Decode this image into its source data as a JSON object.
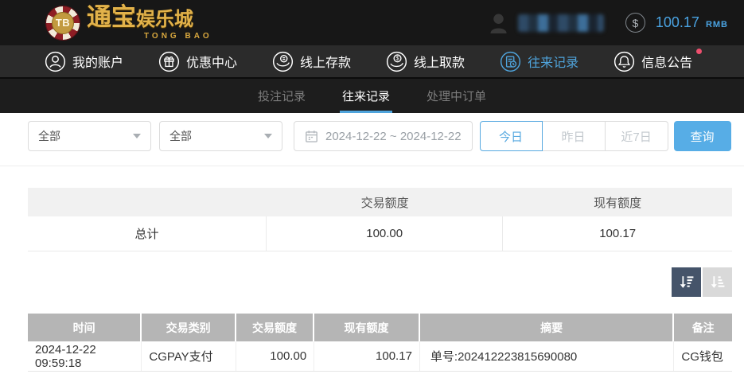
{
  "topbar": {
    "logo": {
      "chip": "TB",
      "name_cn_big": "通宝",
      "name_cn_small": "娱乐城",
      "name_en": "TONG BAO"
    },
    "user": {
      "balance": "100.17",
      "currency": "RMB"
    }
  },
  "nav": {
    "items": [
      {
        "label": "我的账户",
        "icon": "user-icon"
      },
      {
        "label": "优惠中心",
        "icon": "gift-icon"
      },
      {
        "label": "线上存款",
        "icon": "deposit-icon"
      },
      {
        "label": "线上取款",
        "icon": "withdraw-icon"
      },
      {
        "label": "往来记录",
        "icon": "records-icon"
      },
      {
        "label": "信息公告",
        "icon": "bell-icon"
      }
    ],
    "active": "往来记录",
    "notification_badge": true
  },
  "subtabs": {
    "items": [
      {
        "label": "投注记录"
      },
      {
        "label": "往来记录"
      },
      {
        "label": "处理中订单"
      }
    ],
    "active": "往来记录"
  },
  "filters": {
    "type_select_value": "全部",
    "category_select_value": "全部",
    "date_range_value": "2024-12-22 ~ 2024-12-22",
    "quick_buttons": [
      "今日",
      "昨日",
      "近7日"
    ],
    "active_quick": "今日",
    "search_label": "查询"
  },
  "summary_table": {
    "headers": [
      "",
      "交易额度",
      "现有额度"
    ],
    "row": {
      "label": "总计",
      "transaction_amount": "100.00",
      "current_balance": "100.17"
    }
  },
  "data_table": {
    "headers": [
      "时间",
      "交易类别",
      "交易额度",
      "现有额度",
      "摘要",
      "备注"
    ],
    "rows": [
      [
        "2024-12-22 09:59:18",
        "CGPAY支付",
        "100.00",
        "100.17",
        "单号:202412223815690080",
        "CG钱包"
      ]
    ]
  },
  "accent_colors": {
    "blue": "#4fa4dc",
    "button_blue": "#57ade6",
    "badge_red": "#ee4f6e",
    "logo_gold": "#e2b24a",
    "sort_active_bg": "#45546a",
    "sort_inactive_bg": "#d9d9d9"
  }
}
